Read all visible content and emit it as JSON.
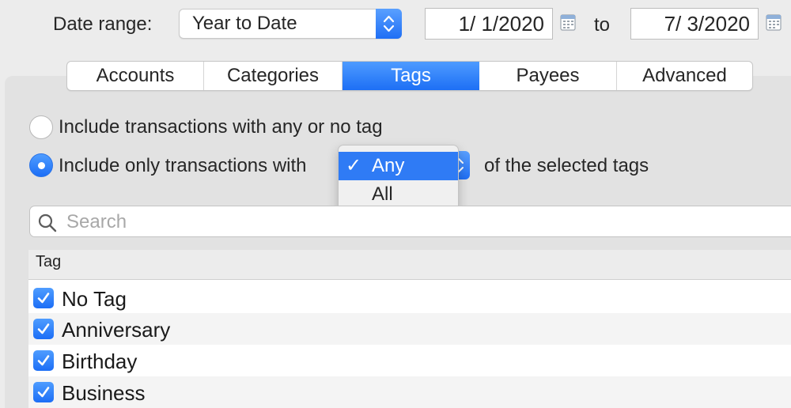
{
  "date_range": {
    "label": "Date range:",
    "selected": "Year to Date",
    "start_date": "1/  1/2020",
    "to_label": "to",
    "end_date": "7/  3/2020"
  },
  "tabs": [
    {
      "label": "Accounts",
      "active": false
    },
    {
      "label": "Categories",
      "active": false
    },
    {
      "label": "Tags",
      "active": true
    },
    {
      "label": "Payees",
      "active": false
    },
    {
      "label": "Advanced",
      "active": false
    }
  ],
  "tag_filter": {
    "option_any_or_none": "Include transactions with any or no tag",
    "option_only_prefix": "Include only transactions with",
    "option_only_suffix": "of the selected tags",
    "selected_option": "option_only",
    "match_menu": {
      "items": [
        "Any",
        "All"
      ],
      "selected": "Any",
      "check_glyph": "✓"
    }
  },
  "search": {
    "placeholder": "Search",
    "value": ""
  },
  "table": {
    "header": "Tag",
    "rows": [
      {
        "name": "No Tag",
        "checked": true
      },
      {
        "name": "Anniversary",
        "checked": true
      },
      {
        "name": "Birthday",
        "checked": true
      },
      {
        "name": "Business",
        "checked": true
      }
    ]
  },
  "icons": {
    "calendar": "calendar-icon",
    "search": "magnifier-icon",
    "stepper": "chevron-up-down-icon",
    "checkbox": "checkmark-icon"
  },
  "colors": {
    "accent": "#1f6ff5",
    "background": "#ececec",
    "panel": "#e2e2e2"
  }
}
